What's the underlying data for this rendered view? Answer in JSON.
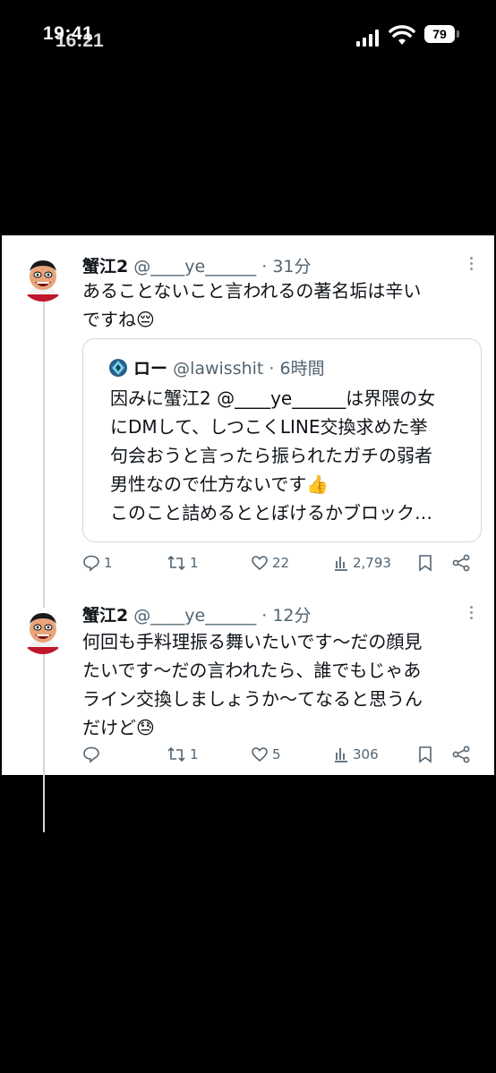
{
  "status_bar": {
    "time": "19:41",
    "time_overlay": "16:21",
    "battery": "79"
  },
  "tweets": [
    {
      "name": "蟹江2",
      "handle": "@____ye______",
      "time": "· 31分",
      "text_line1": "あることないこと言われるの著名垢は辛い",
      "text_line2": "ですね",
      "emoji": "😔",
      "quote": {
        "name": "ロー",
        "handle": "@lawisshit",
        "time": "· 6時間",
        "lines": [
          "因みに蟹江2 @____ye______は界隈の女",
          "にDMして、しつこくLINE交換求めた挙",
          "句会おうと言ったら振られたガチの弱者",
          "男性なので仕方ないです👍",
          "このこと詰めるととぼけるかブロック…"
        ]
      },
      "actions": {
        "replies": "1",
        "retweets": "1",
        "likes": "22",
        "views": "2,793"
      }
    },
    {
      "name": "蟹江2",
      "handle": "@____ye______",
      "time": "· 12分",
      "lines": [
        "何回も手料理振る舞いたいです〜だの顔見",
        "たいです〜だの言われたら、誰でもじゃあ",
        "ライン交換しましょうか〜てなると思うん",
        "だけど😓"
      ],
      "actions": {
        "replies": "",
        "retweets": "1",
        "likes": "5",
        "views": "306"
      }
    }
  ],
  "icons": [
    "reply-icon",
    "retweet-icon",
    "like-icon",
    "views-icon",
    "bookmark-icon",
    "share-icon",
    "more-icon",
    "signal-icon",
    "wifi-icon",
    "battery-icon"
  ],
  "colors": {
    "text": "#0f1419",
    "secondary": "#536471",
    "border": "#cfd9de",
    "background": "#ffffff",
    "frame": "#000000"
  }
}
